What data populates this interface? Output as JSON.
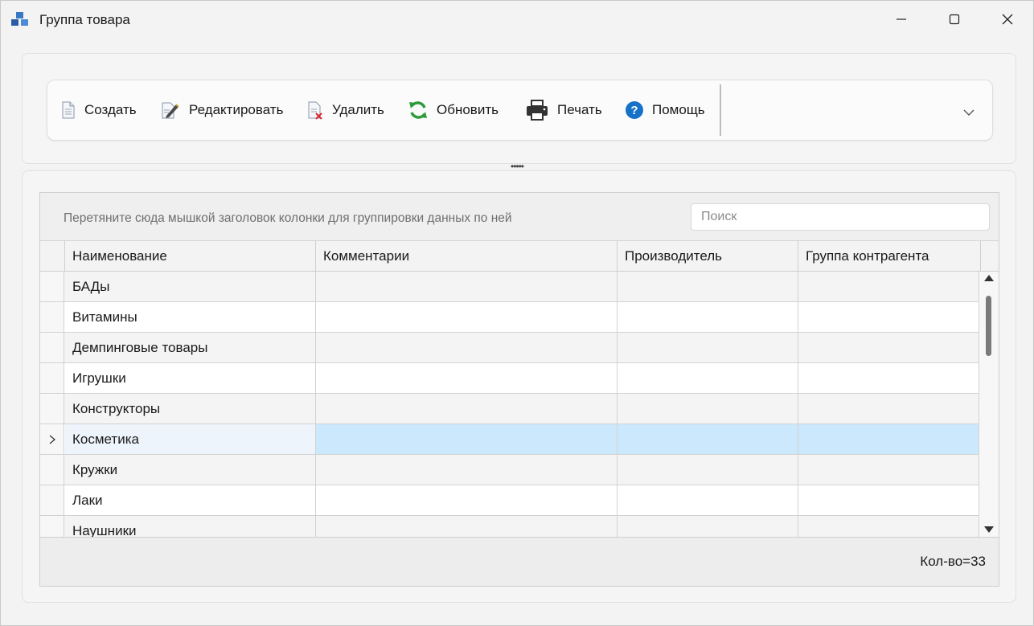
{
  "window": {
    "title": "Группа товара"
  },
  "toolbar": {
    "buttons": [
      {
        "label": "Создать",
        "icon": "new-document-icon"
      },
      {
        "label": "Редактировать",
        "icon": "edit-pen-icon"
      },
      {
        "label": "Удалить",
        "icon": "delete-document-icon"
      },
      {
        "label": "Обновить",
        "icon": "refresh-icon"
      },
      {
        "label": "Печать",
        "icon": "printer-icon"
      },
      {
        "label": "Помощь",
        "icon": "help-icon"
      }
    ]
  },
  "grid": {
    "group_hint": "Перетяните сюда мышкой заголовок колонки для группировки данных по ней",
    "search_placeholder": "Поиск",
    "columns": [
      "Наименование",
      "Комментарии",
      "Производитель",
      "Группа контрагента"
    ],
    "rows": [
      {
        "name": "БАДы",
        "comment": "",
        "maker": "",
        "group": ""
      },
      {
        "name": "Витамины",
        "comment": "",
        "maker": "",
        "group": ""
      },
      {
        "name": "Демпинговые товары",
        "comment": "",
        "maker": "",
        "group": ""
      },
      {
        "name": "Игрушки",
        "comment": "",
        "maker": "",
        "group": ""
      },
      {
        "name": "Конструкторы",
        "comment": "",
        "maker": "",
        "group": ""
      },
      {
        "name": "Косметика",
        "comment": "",
        "maker": "",
        "group": "",
        "selected": true
      },
      {
        "name": "Кружки",
        "comment": "",
        "maker": "",
        "group": ""
      },
      {
        "name": "Лаки",
        "comment": "",
        "maker": "",
        "group": ""
      },
      {
        "name": "Наушники",
        "comment": "",
        "maker": "",
        "group": ""
      }
    ],
    "count_text": "Кол-во=33"
  },
  "colors": {
    "selection": "#cce8fc",
    "refresh_green": "#2e9b3a",
    "help_blue": "#1672c9"
  }
}
